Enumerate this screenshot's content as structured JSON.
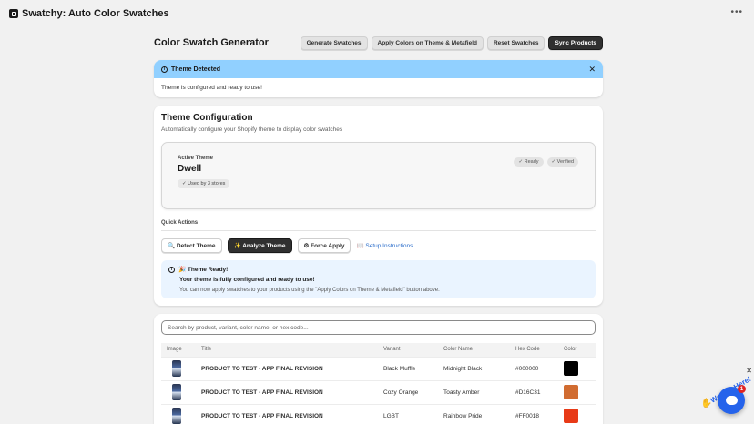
{
  "app": {
    "title": "Swatchy: Auto Color Swatches",
    "more_icon": "more-horizontal-icon"
  },
  "header": {
    "title": "Color Swatch Generator",
    "actions": [
      "Generate Swatches",
      "Apply Colors on Theme & Metafield",
      "Reset Swatches",
      "Sync Products"
    ]
  },
  "banner": {
    "title": "Theme Detected",
    "message": "Theme is configured and ready to use!",
    "color": "#91d0ff"
  },
  "theme_config": {
    "title": "Theme Configuration",
    "subtitle": "Automatically configure your Shopify theme to display color swatches",
    "active_label": "Active Theme",
    "active_name": "Dwell",
    "used_by": "✓ Used by 3 stores",
    "status": [
      "✓ Ready",
      "✓ Verified"
    ],
    "quick_actions_label": "Quick Actions",
    "quick_actions": [
      "🔍 Detect Theme",
      "✨ Analyze Theme",
      "⚙ Force Apply"
    ],
    "setup_link": "📖 Setup Instructions",
    "ready": {
      "title": "🎉 Theme Ready!",
      "subtitle": "Your theme is fully configured and ready to use!",
      "note": "You can now apply swatches to your products using the \"Apply Colors on Theme & Metafield\" button above."
    }
  },
  "table": {
    "search_placeholder": "Search by product, variant, color name, or hex code...",
    "columns": [
      "Image",
      "Title",
      "Variant",
      "Color Name",
      "Hex Code",
      "Color"
    ],
    "rows": [
      {
        "title": "PRODUCT TO TEST - APP FINAL REVISION",
        "variant": "Black Muffle",
        "color_name": "Midnight Black",
        "hex": "#000000",
        "swatch": "#000000"
      },
      {
        "title": "PRODUCT TO TEST - APP FINAL REVISION",
        "variant": "Cozy Orange",
        "color_name": "Toasty Amber",
        "hex": "#D16C31",
        "swatch": "#D16C31"
      },
      {
        "title": "PRODUCT TO TEST - APP FINAL REVISION",
        "variant": "LGBT",
        "color_name": "Rainbow Pride",
        "hex": "#FF0018",
        "swatch": "#E83A17"
      }
    ]
  },
  "chat": {
    "greeting": "We Are Here!",
    "unread": "1"
  }
}
